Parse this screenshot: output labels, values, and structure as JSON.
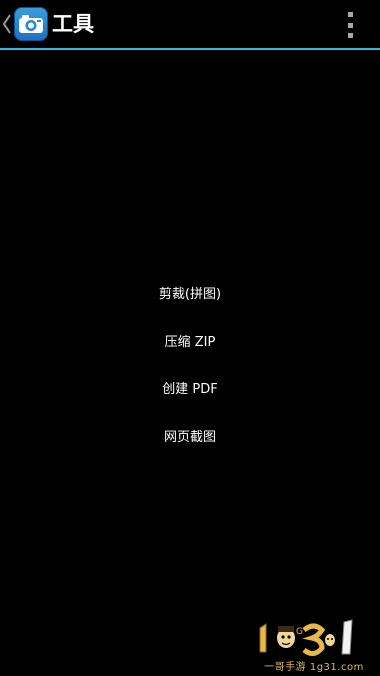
{
  "action_bar": {
    "title": "工具",
    "icons": {
      "back": "chevron-left-icon",
      "app": "camera-icon",
      "overflow": "overflow-menu-icon"
    },
    "accent_color": "#33b5e5"
  },
  "menu": {
    "items": [
      {
        "label": "剪裁(拼图)"
      },
      {
        "label": "压缩 ZIP"
      },
      {
        "label": "创建 PDF"
      },
      {
        "label": "网页截图"
      }
    ]
  },
  "watermark": {
    "logo": "1 G 3 1",
    "text": "一哥手游 1g31.com"
  }
}
